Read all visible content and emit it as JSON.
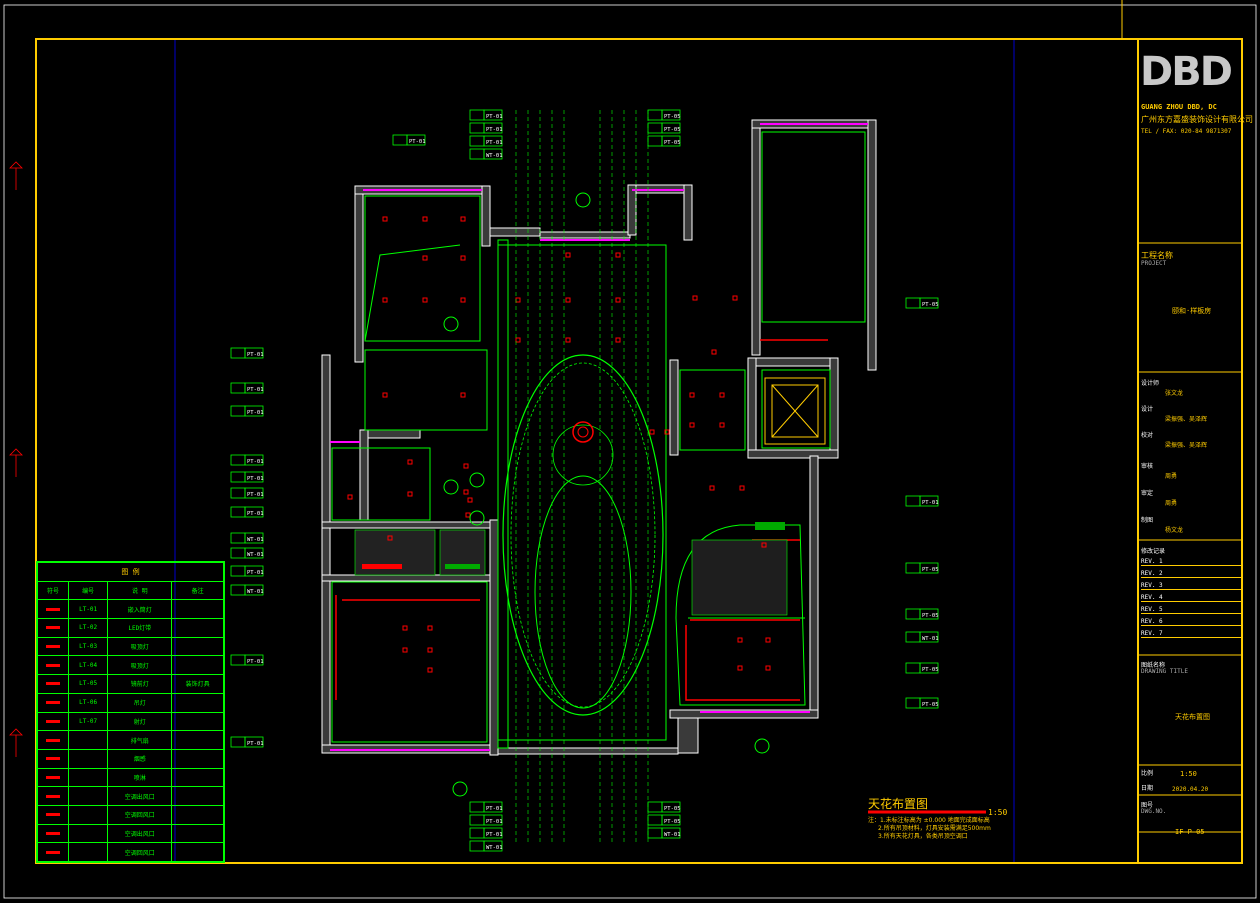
{
  "company": {
    "logo_text": "DBD",
    "name_en": "GUANG ZHOU DBD, DC",
    "name_cn": "广州东方嘉盛装饰设计有限公司",
    "tel": "TEL / FAX:  020-84 9871307"
  },
  "title_block": {
    "project_label": "工程名称",
    "project_sub": "PROJECT",
    "project_name": "颐和·样板房",
    "rows": [
      {
        "label": "设计师",
        "value": "张文龙"
      },
      {
        "label": "设计",
        "value": "梁振强、吴泽辉"
      },
      {
        "label": "校对",
        "value": "梁振强、吴泽辉"
      },
      {
        "label": "审核",
        "value": "周勇"
      },
      {
        "label": "审定",
        "value": "周勇"
      },
      {
        "label": "制图",
        "value": "杨文龙"
      }
    ],
    "revisions_label": "修改记录",
    "revision_rows": [
      "REV. 1",
      "REV. 2",
      "REV. 3",
      "REV. 4",
      "REV. 5",
      "REV. 6",
      "REV. 7"
    ],
    "drawing_label": "图纸名称",
    "drawing_sub": "DRAWING TITLE",
    "drawing_name": "天花布置图",
    "scale_label": "比例",
    "scale": "1:50",
    "date_label": "日期",
    "date": "2020.04.20",
    "no_label": "图号",
    "no_sub": "DWG.NO.",
    "drawing_no": "IF-P-05"
  },
  "legend": {
    "title": "图 例",
    "headers": [
      "符号",
      "编号",
      "说 明",
      "备注"
    ],
    "rows": [
      {
        "code": "LT-01",
        "desc": "嵌入筒灯",
        "note": ""
      },
      {
        "code": "LT-02",
        "desc": "LED灯带",
        "note": ""
      },
      {
        "code": "LT-03",
        "desc": "吸顶灯",
        "note": ""
      },
      {
        "code": "LT-04",
        "desc": "吸顶灯",
        "note": ""
      },
      {
        "code": "LT-05",
        "desc": "镜前灯",
        "note": "装饰灯具"
      },
      {
        "code": "LT-06",
        "desc": "吊灯",
        "note": ""
      },
      {
        "code": "LT-07",
        "desc": "射灯",
        "note": ""
      },
      {
        "code": "",
        "desc": "排气扇",
        "note": ""
      },
      {
        "code": "",
        "desc": "烟感",
        "note": ""
      },
      {
        "code": "",
        "desc": "喷淋",
        "note": ""
      },
      {
        "code": "",
        "desc": "空调出风口",
        "note": ""
      },
      {
        "code": "",
        "desc": "空调回风口",
        "note": ""
      },
      {
        "code": "",
        "desc": "空调出风口",
        "note": ""
      },
      {
        "code": "",
        "desc": "空调回风口",
        "note": ""
      }
    ]
  },
  "plan_title": {
    "name": "天花布置图",
    "scale": "1:50",
    "notes": [
      "注：1.未标注标高为 ±0.000 地面完成面标高",
      "2.所有吊顶材料，灯具安装需满足500mm",
      "3.所有天花灯具，各类吊顶空调口"
    ]
  },
  "tags": {
    "top": [
      "PT-01",
      "PT-01",
      "PT-01",
      "WT-01",
      "PT-05",
      "PT-05",
      "PT-05"
    ],
    "left": [
      "PT-01",
      "PT-01",
      "PT-01",
      "PT-01",
      "PT-01",
      "PT-01",
      "PT-01",
      "WT-01",
      "WT-01",
      "PT-01",
      "WT-01",
      "PT-01",
      "PT-01"
    ],
    "right": [
      "PT-05",
      "PT-01",
      "PT-05",
      "PT-05",
      "WT-01",
      "PT-05",
      "PT-05"
    ],
    "bottom": [
      "PT-01",
      "PT-01",
      "PT-01",
      "WT-01",
      "PT-05",
      "PT-05",
      "WT-01"
    ]
  },
  "colors": {
    "frame": "#ffcc00",
    "wall": "#ffffff",
    "ceiling": "#00ff00",
    "accent": "#ff0000",
    "magenta": "#ff00ff",
    "axis": "#0000ff"
  }
}
